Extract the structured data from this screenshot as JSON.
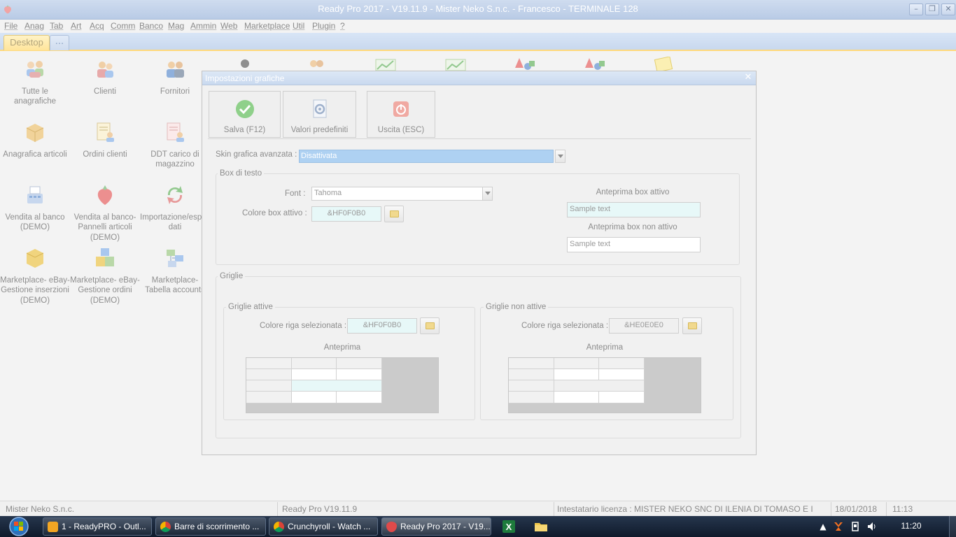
{
  "window": {
    "title": "Ready Pro 2017 - V19.11.9 - Mister Neko S.n.c. - Francesco - TERMINALE 128",
    "minimize_label": "–",
    "restore_label": "❐",
    "close_label": "✕"
  },
  "menu": {
    "items": [
      "File",
      "Anag",
      "Tab",
      "Art",
      "Acq",
      "Comm",
      "Banco",
      "Mag",
      "Ammin",
      "Web",
      "Marketplace",
      "Util",
      "Plugin",
      "?"
    ]
  },
  "tabs": {
    "desktop": "Desktop",
    "more": "..."
  },
  "desktop_icons": [
    {
      "label": "Tutte le\nanagrafiche",
      "icon": "people-group-icon"
    },
    {
      "label": "Clienti",
      "icon": "customers-icon"
    },
    {
      "label": "Fornitori",
      "icon": "suppliers-icon"
    },
    {
      "label": "Anagrafica articoli",
      "icon": "package-icon"
    },
    {
      "label": "Ordini clienti",
      "icon": "customer-orders-icon"
    },
    {
      "label": "DDT carico di\nmagazzino",
      "icon": "warehouse-document-icon"
    },
    {
      "label": "Vendita al banco\n(DEMO)",
      "icon": "cash-register-icon"
    },
    {
      "label": "Vendita al banco-\nPannelli articoli\n(DEMO)",
      "icon": "strawberry-icon"
    },
    {
      "label": "Importazione/esportazione\ndati",
      "icon": "import-export-icon"
    },
    {
      "label": "Marketplace- eBay-\nGestione inserzioni\n(DEMO)",
      "icon": "marketplace-box-icon"
    },
    {
      "label": "Marketplace- eBay-\nGestione ordini\n(DEMO)",
      "icon": "marketplace-boxes-icon"
    },
    {
      "label": "Marketplace-\nTabella accounts",
      "icon": "accounts-network-icon"
    }
  ],
  "dialog": {
    "title": "Impostazioni grafiche",
    "close_label": "✕",
    "toolbar": {
      "save_label": "Salva (F12)",
      "defaults_label": "Valori predefiniti",
      "exit_label": "Uscita (ESC)"
    },
    "skin": {
      "label": "Skin grafica avanzata :",
      "value": "Disattivata"
    },
    "textbox_group": {
      "title": "Box di testo",
      "font_label": "Font :",
      "font_value": "Tahoma",
      "active_color_label": "Colore box attivo :",
      "active_color_value": "&HF0F0B0",
      "preview_active_label": "Anteprima box attivo",
      "preview_active_text": "Sample text",
      "preview_inactive_label": "Anteprima box non attivo",
      "preview_inactive_text": "Sample text"
    },
    "grids_group": {
      "title": "Griglie",
      "active": {
        "title": "Griglie attive",
        "row_color_label": "Colore riga selezionata :",
        "row_color_value": "&HF0F0B0",
        "preview_label": "Anteprima"
      },
      "inactive": {
        "title": "Griglie non attive",
        "row_color_label": "Colore riga selezionata :",
        "row_color_value": "&HE0E0E0",
        "preview_label": "Anteprima"
      }
    }
  },
  "statusbar": {
    "company": "Mister Neko S.n.c.",
    "version": "Ready Pro V19.11.9",
    "license": "Intestatario licenza : MISTER NEKO SNC DI ILENIA DI TOMASO E I",
    "date": "18/01/2018",
    "time": "11:13"
  },
  "taskbar": {
    "tasks": [
      {
        "label": "1 - ReadyPRO - Outl...",
        "icon": "outlook-icon"
      },
      {
        "label": "Barre di scorrimento ...",
        "icon": "chrome-icon"
      },
      {
        "label": "Crunchyroll - Watch ...",
        "icon": "chrome-icon"
      },
      {
        "label": "Ready Pro 2017 - V19...",
        "icon": "strawberry-icon"
      }
    ],
    "clock": "11:20"
  },
  "colors": {
    "active_box": "#e7f8f8",
    "inactive_row": "#f0f0f0",
    "accent_tab": "#ffe49a"
  }
}
